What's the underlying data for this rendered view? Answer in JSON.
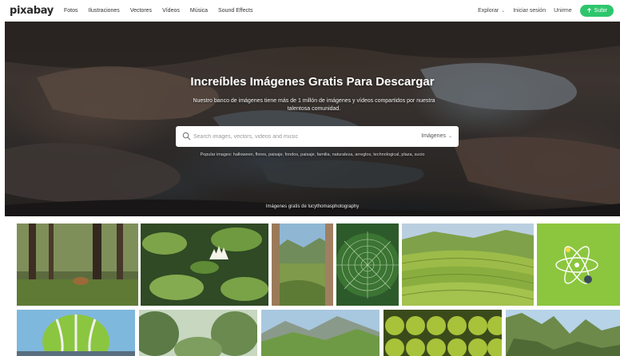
{
  "nav": {
    "logo": "pixabay",
    "links": [
      "Fotos",
      "Ilustraciones",
      "Vectores",
      "Vídeos",
      "Música",
      "Sound Effects"
    ],
    "explore": "Explorar",
    "login": "Iniciar sesión",
    "join": "Unirme",
    "upload": "Subir"
  },
  "hero": {
    "title": "Increíbles Imágenes Gratis Para Descargar",
    "subtitle": "Nuestro banco de imágenes tiene más de 1 millón de imágenes y vídeos compartidos por nuestra talentosa comunidad.",
    "search_placeholder": "Search images, vectors, videos and music",
    "search_type": "Imágenes",
    "popular": "Popular images: halloween, flores, paisaje, fondos, paisaje, familia, naturaleza, arreglos, technological, plaza, sucio",
    "credit": "Imágenes gratis de lucythomasphotography"
  },
  "colors": {
    "accent": "#2ec66d"
  },
  "gallery": [
    "forest-deer",
    "water-lily",
    "mountain-valley",
    "spider-web",
    "rice-terraces",
    "atom-illustration",
    "hot-air-balloon",
    "jungle-foliage",
    "green-mountains",
    "green-apples",
    "rocky-cliffs"
  ]
}
